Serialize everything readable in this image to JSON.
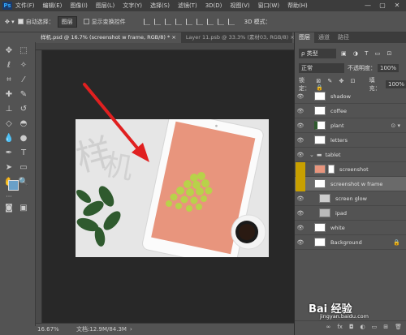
{
  "menubar": {
    "logo": "Ps",
    "items": [
      "文件(F)",
      "编辑(E)",
      "图像(I)",
      "图层(L)",
      "文字(Y)",
      "选择(S)",
      "滤镜(T)",
      "3D(D)",
      "视图(V)",
      "窗口(W)",
      "帮助(H)"
    ],
    "win": [
      "—",
      "▢",
      "✕"
    ]
  },
  "options": {
    "auto_select_label": "自动选择：",
    "auto_select_value": "图层",
    "show_transform": "显示变换控件",
    "mode3d": "3D 模式："
  },
  "tabs": [
    {
      "label": "样机.psd @ 16.7% (screenshot w frame, RGB/8) *",
      "active": true
    },
    {
      "label": "Layer 11.psb @ 33.3% (素材03, RGB/8)",
      "active": false
    }
  ],
  "status": {
    "zoom": "16.67%",
    "doc": "文档:12.9M/84.3M"
  },
  "panel": {
    "tabs": [
      "图层",
      "通道",
      "路径"
    ],
    "filter_label": "ρ 类型",
    "blend": "正常",
    "opacity_label": "不透明度：",
    "opacity": "100%",
    "lock_label": "锁定：",
    "fill_label": "填充：",
    "fill": "100%",
    "layers": [
      {
        "name": "shadow",
        "indent": 0,
        "selected": false,
        "fx": false
      },
      {
        "name": "coffee",
        "indent": 0,
        "selected": false,
        "fx": false
      },
      {
        "name": "plant",
        "indent": 0,
        "selected": false,
        "fx": true
      },
      {
        "name": "letters",
        "indent": 0,
        "selected": false,
        "fx": false
      },
      {
        "name": "tablet",
        "indent": 0,
        "selected": false,
        "fx": false,
        "group": true
      },
      {
        "name": "screenshot",
        "indent": 1,
        "selected": false,
        "fx": false
      },
      {
        "name": "screenshot w frame",
        "indent": 1,
        "selected": true,
        "fx": false
      },
      {
        "name": "screen glow",
        "indent": 1,
        "selected": false,
        "fx": false
      },
      {
        "name": "ipad",
        "indent": 1,
        "selected": false,
        "fx": false
      },
      {
        "name": "white",
        "indent": 0,
        "selected": false,
        "fx": false
      },
      {
        "name": "Background",
        "indent": 0,
        "selected": false,
        "fx": false,
        "lock": true
      }
    ],
    "footer": [
      "∞",
      "fx",
      "◘",
      "◐",
      "▭",
      "⊞",
      "🗑"
    ]
  },
  "watermark": {
    "brand": "Bai 经验",
    "url": "jingyan.baidu.com"
  },
  "colors": {
    "screen": "#e8957d",
    "arrow": "#e02020",
    "accent": "#6aa0c8"
  }
}
